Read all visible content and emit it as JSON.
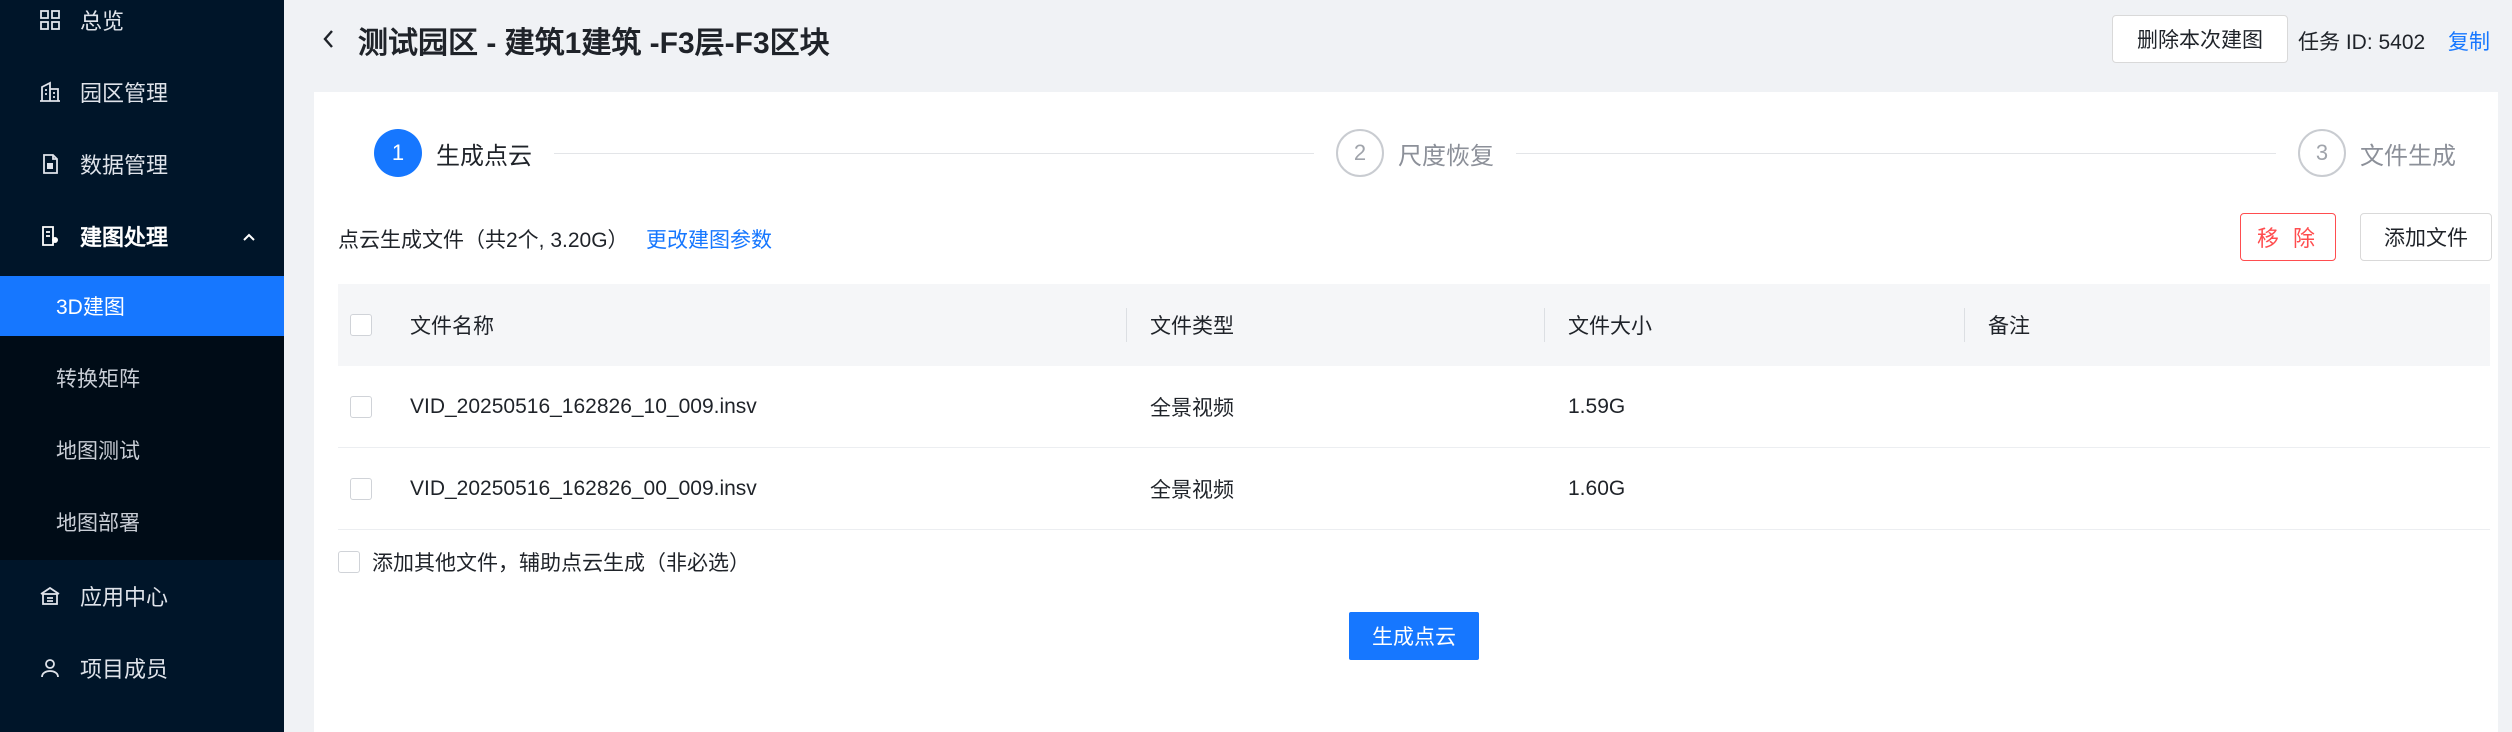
{
  "sidebar": {
    "items": [
      {
        "label": "总览",
        "icon": "grid-icon"
      },
      {
        "label": "园区管理",
        "icon": "building-icon"
      },
      {
        "label": "数据管理",
        "icon": "document-icon"
      },
      {
        "label": "建图处理",
        "icon": "map-edit-icon",
        "expanded": true
      },
      {
        "label": "应用中心",
        "icon": "app-center-icon"
      },
      {
        "label": "项目成员",
        "icon": "user-icon"
      }
    ],
    "submenu": [
      {
        "label": "3D建图",
        "active": true
      },
      {
        "label": "转换矩阵"
      },
      {
        "label": "地图测试"
      },
      {
        "label": "地图部署"
      }
    ]
  },
  "header": {
    "title": "测试园区 - 建筑1建筑 -F3层-F3区块",
    "delete_label": "删除本次建图",
    "task_id": "任务 ID: 5402",
    "copy_label": "复制"
  },
  "steps": [
    {
      "num": "1",
      "label": "生成点云",
      "status": "active"
    },
    {
      "num": "2",
      "label": "尺度恢复",
      "status": "wait"
    },
    {
      "num": "3",
      "label": "文件生成",
      "status": "wait"
    }
  ],
  "toolbar": {
    "file_summary": "点云生成文件（共2个, 3.20G）",
    "edit_params_label": "更改建图参数",
    "remove_label": "移 除",
    "add_file_label": "添加文件"
  },
  "table": {
    "headers": [
      "文件名称",
      "文件类型",
      "文件大小",
      "备注"
    ],
    "rows": [
      {
        "name": "VID_20250516_162826_10_009.insv",
        "type": "全景视频",
        "size": "1.59G",
        "note": ""
      },
      {
        "name": "VID_20250516_162826_00_009.insv",
        "type": "全景视频",
        "size": "1.60G",
        "note": ""
      }
    ]
  },
  "extra_option_label": "添加其他文件，辅助点云生成（非必选）",
  "generate_label": "生成点云",
  "colors": {
    "sidebar_bg": "#001529",
    "submenu_bg": "#000c17",
    "accent": "#1677ff",
    "danger": "#ff4d4f"
  }
}
